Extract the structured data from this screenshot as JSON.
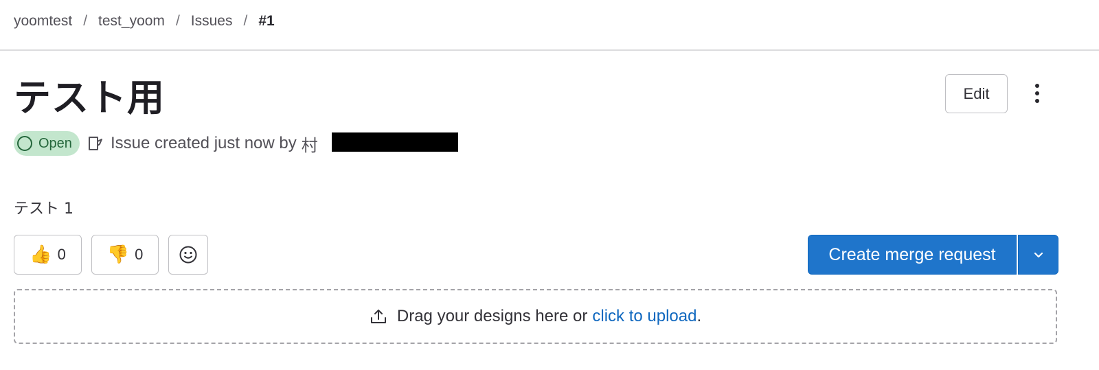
{
  "breadcrumb": {
    "items": [
      "yoomtest",
      "test_yoom",
      "Issues"
    ],
    "separator": "/",
    "current": "#1"
  },
  "issue": {
    "title": "テスト用",
    "status": "Open",
    "meta_text": "Issue created just now by",
    "meta_author_initial": "村",
    "description": "テスト 1"
  },
  "actions": {
    "edit_label": "Edit",
    "more_icon": "ellipsis-v-icon",
    "create_merge_request_label": "Create merge request",
    "dropdown_icon": "chevron-down-icon"
  },
  "reactions": {
    "thumbsup_emoji": "👍",
    "thumbsup_count": "0",
    "thumbsdown_emoji": "👎",
    "thumbsdown_count": "0",
    "add_emoji_icon": "smiley-icon"
  },
  "upload": {
    "text_before": "Drag your designs here or",
    "link_text": "click to upload",
    "text_after": "."
  },
  "colors": {
    "primary": "#1f75cb",
    "status_open_bg": "#c3e6cd",
    "status_open_fg": "#24663b",
    "link": "#1068bf"
  }
}
